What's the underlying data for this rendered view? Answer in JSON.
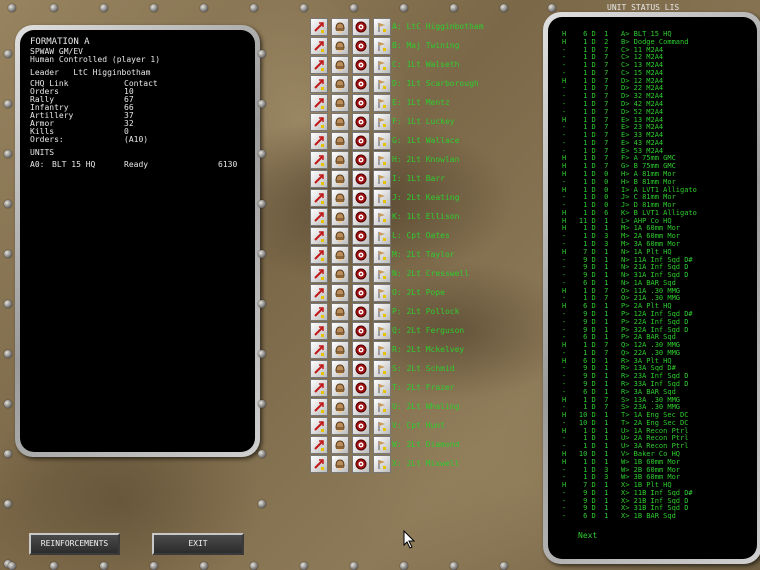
{
  "formation": {
    "title": "FORMATION A",
    "subtitle": "SPWAW GM/EV",
    "control": "Human Controlled (player 1)",
    "leader": "Leader   LtC Higginbotham",
    "stats": [
      {
        "label": "CHQ Link",
        "value": "Contact"
      },
      {
        "label": "Orders",
        "value": "10"
      },
      {
        "label": "Rally",
        "value": "67"
      },
      {
        "label": "Infantry",
        "value": "66"
      },
      {
        "label": "Artillery",
        "value": "37"
      },
      {
        "label": "Armor",
        "value": "32"
      },
      {
        "label": "Kills",
        "value": "0"
      },
      {
        "label": "Orders:",
        "value": "(A10)"
      }
    ],
    "units_header": "UNITS",
    "unit_row": {
      "id": "A0:",
      "name": "BLT 15 HQ",
      "state": "Ready",
      "value": "6130"
    }
  },
  "units": [
    "A: LtC Higginbotham",
    "B: Maj Twining",
    "C: 1Lt Walseth",
    "D: 1Lt Scarborough",
    "E: 1Lt Mentz",
    "F: 1Lt Luckey",
    "G: 1Lt Wallace",
    "H: 2Lt Knowlan",
    "I: 1Lt Barr",
    "J: 2Lt Keating",
    "K: 1Lt Ellison",
    "L: Cpt Oates",
    "M: 2Lt Taylor",
    "N: 2Lt Cresswell",
    "O: 2Lt Pope",
    "P: 2Lt Pollock",
    "Q: 2Lt Ferguson",
    "R: 2Lt Mckelvey",
    "S: 2Lt Schmid",
    "T: 2Lt Frazer",
    "U: 2Lt Whaling",
    "V: Cpt Hunt",
    "W: 2Lt Diamond",
    "X: 2Lt Mixwell"
  ],
  "status": {
    "title": "UNIT STATUS LIS",
    "next_label": "Next",
    "rows": [
      "H    6 D  1   A> BLT 15 HQ",
      "H    1 D  2   B> Dodge Command",
      "-    1 D  7   C> 11 M2A4",
      "-    1 D  7   C> 12 M2A4",
      "-    1 D  7   C> 13 M2A4",
      "-    1 D  7   C> 15 M2A4",
      "H    1 D  7   D> 12 M2A4",
      "-    1 D  7   D> 22 M2A4",
      "-    1 D  7   D> 32 M2A4",
      "-    1 D  7   D> 42 M2A4",
      "-    1 D  7   D> 52 M2A4",
      "H    1 D  7   E> 13 M2A4",
      "-    1 D  7   E> 23 M2A4",
      "-    1 D  7   E> 33 M2A4",
      "-    1 D  7   E> 43 M2A4",
      "-    1 D  7   E> 53 M2A4",
      "H    1 D  7   F> A 75mm GMC",
      "H    1 D  7   G> B 75mm GMC",
      "H    1 D  0   H> A 81mm Mor",
      "-    1 D  0   H> B 81mm Mor",
      "H    1 D  0   I> A LVT1 Alligato",
      "-    1 D  0   J> C 81mm Mor",
      "-    1 D  0   J> D 81mm Mor",
      "H    1 D  6   K> B LVT1 Alligato",
      "H   11 D  1   L> AHP Co HQ",
      "H    1 D  1   M> 1A 60mm Mor",
      "-    1 D  3   M> 2A 60mm Mor",
      "-    1 D  3   M> 3A 60mm Mor",
      "H    7 D  1   N> 1A Plt HQ",
      "-    9 D  1   N> 11A Inf Sqd D#",
      "-    9 D  1   N> 21A Inf Sqd D",
      "-    9 D  1   N> 31A Inf Sqd D",
      "-    6 D  1   N> 1A BAR Sqd",
      "H    1 D  7   O> 11A .30 MMG",
      "-    1 D  7   O> 21A .30 MMG",
      "H    6 D  1   P> 2A Plt HQ",
      "-    9 D  1   P> 12A Inf Sqd D#",
      "-    9 D  1   P> 22A Inf Sqd D",
      "-    9 D  1   P> 32A Inf Sqd D",
      "-    6 D  1   P> 2A BAR Sqd",
      "H    1 D  7   Q> 12A .30 MMG",
      "-    1 D  7   Q> 22A .30 MMG",
      "H    6 D  1   R> 3A Plt HQ",
      "-    9 D  1   R> 13A Sqd D#",
      "-    9 D  1   R> 23A Inf Sqd D",
      "-    9 D  1   R> 33A Inf Sqd D",
      "-    6 D  1   R> 3A BAR Sqd",
      "H    1 D  7   S> 13A .30 MMG",
      "-    1 D  7   S> 23A .30 MMG",
      "H   10 D  1   T> 1A Eng Sec DC",
      "-   10 D  1   T> 2A Eng Sec DC",
      "H    1 D  1   U> 1A Recon Ptrl",
      "-    1 D  1   U> 2A Recon Ptrl",
      "-    1 D  1   U> 3A Recon Ptrl",
      "H   10 D  1   V> Baker Co HQ",
      "H    1 D  1   W> 1B 60mm Mor",
      "-    1 D  3   W> 2B 60mm Mor",
      "-    1 D  3   W> 3B 60mm Mor",
      "H    7 D  1   X> 1B Plt HQ",
      "-    9 D  1   X> 11B Inf Sqd D#",
      "-    9 D  1   X> 21B Inf Sqd D",
      "-    9 D  1   X> 31B Inf Sqd D",
      "-    6 D  1   X> 1B BAR Sqd"
    ]
  },
  "buttons": {
    "reinforcements": "REINFORCEMENTS",
    "exit": "EXIT"
  }
}
